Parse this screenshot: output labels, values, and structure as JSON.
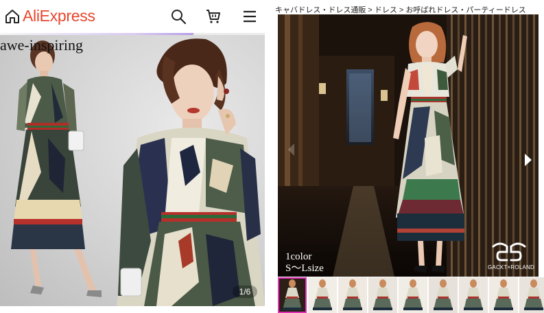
{
  "left_panel": {
    "logo_text": "AliExpress",
    "caption": "awe-inspiring",
    "image_counter": "1/6",
    "icons": {
      "home": "home-icon",
      "search": "search-icon",
      "cart": "cart-icon",
      "menu": "menu-icon"
    },
    "progress": 0.73,
    "colors": {
      "brand": "#e8452c",
      "progress": "#b49be8"
    }
  },
  "right_panel": {
    "breadcrumb": "キャバドレス・ドレス通販 > ドレス > お呼ばれドレス・パーティードレス",
    "color_count": "1color",
    "size_range": "S～Lsize",
    "brand_text": "GACKT×ROLAND",
    "icons": {
      "prev": "chevron-left-icon",
      "next": "chevron-right-icon"
    },
    "thumbnail_count": 9,
    "active_thumbnail": 1,
    "colors": {
      "active_thumb_border": "#e12fb5"
    }
  }
}
